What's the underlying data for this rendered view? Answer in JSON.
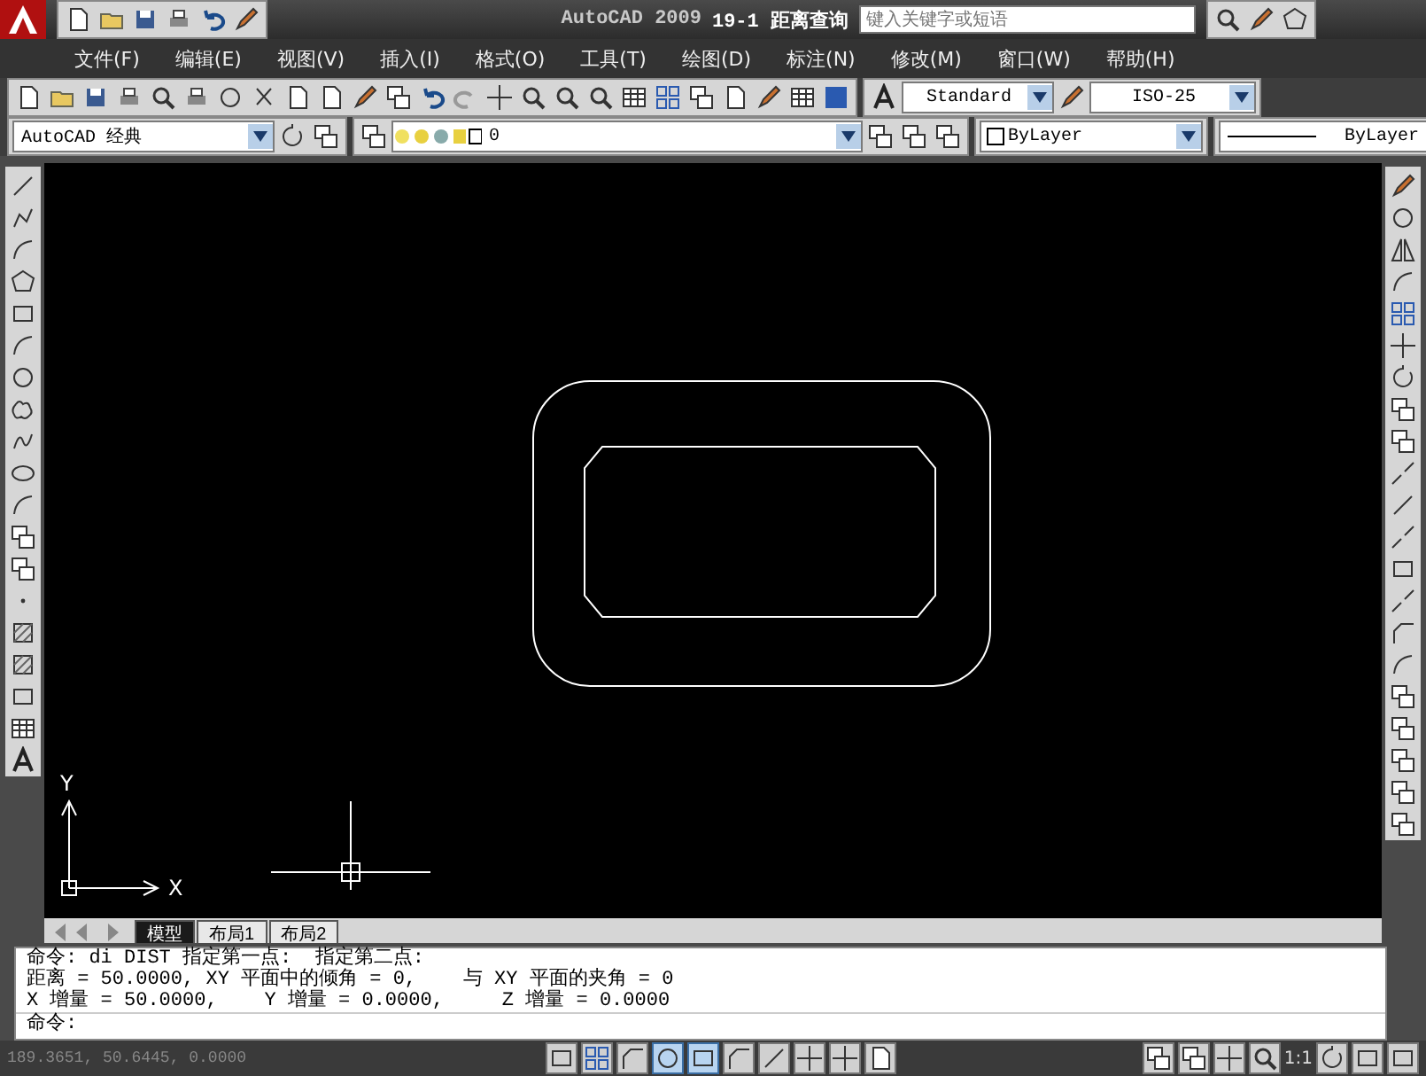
{
  "title_bar": {
    "app": "AutoCAD 2009",
    "document": "19-1 距离查询",
    "search": {
      "placeholder": "键入关键字或短语"
    }
  },
  "menu": [
    {
      "label": "文件(F)"
    },
    {
      "label": "编辑(E)"
    },
    {
      "label": "视图(V)"
    },
    {
      "label": "插入(I)"
    },
    {
      "label": "格式(O)"
    },
    {
      "label": "工具(T)"
    },
    {
      "label": "绘图(D)"
    },
    {
      "label": "标注(N)"
    },
    {
      "label": "修改(M)"
    },
    {
      "label": "窗口(W)"
    },
    {
      "label": "帮助(H)"
    }
  ],
  "styles": {
    "text_style": "Standard",
    "dim_style": "ISO-25"
  },
  "properties": {
    "workspace": "AutoCAD 经典",
    "layer": "0",
    "color_control": "ByLayer",
    "linetype": "ByLayer"
  },
  "canvas": {
    "axis_x": "X",
    "axis_y": "Y"
  },
  "layout_tabs": [
    {
      "label": "模型",
      "selected": true
    },
    {
      "label": "布局1",
      "selected": false
    },
    {
      "label": "布局2",
      "selected": false
    }
  ],
  "command_lines": [
    "命令: di DIST 指定第一点:  指定第二点:",
    "距离 = 50.0000, XY 平面中的倾角 = 0,    与 XY 平面的夹角 = 0",
    "X 增量 = 50.0000,    Y 增量 = 0.0000,     Z 增量 = 0.0000"
  ],
  "prompt": "命令:",
  "status_bar": {
    "coordinates": "189.3651, 50.6445, 0.0000",
    "scale": "1:1",
    "toggles": [
      {
        "on": false
      },
      {
        "on": false
      },
      {
        "on": false
      },
      {
        "on": true
      },
      {
        "on": true
      },
      {
        "on": false
      },
      {
        "on": false
      },
      {
        "on": false
      },
      {
        "on": false
      },
      {
        "on": false
      }
    ]
  }
}
